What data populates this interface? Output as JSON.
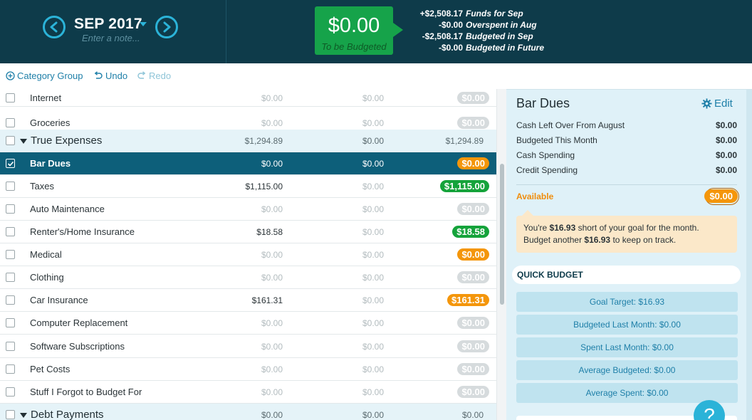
{
  "header": {
    "month": "SEP 2017",
    "note_placeholder": "Enter a note...",
    "to_be_budgeted": {
      "amount": "$0.00",
      "label": "To be Budgeted"
    },
    "summary": [
      {
        "amount": "+$2,508.17",
        "label": "Funds for Sep"
      },
      {
        "amount": "-$0.00",
        "label": "Overspent in Aug"
      },
      {
        "amount": "-$2,508.17",
        "label": "Budgeted in Sep"
      },
      {
        "amount": "-$0.00",
        "label": "Budgeted in Future"
      }
    ]
  },
  "toolbar": {
    "category_group": "Category Group",
    "undo": "Undo",
    "redo": "Redo"
  },
  "rows": [
    {
      "name": "Internet",
      "budgeted": "$0.00",
      "activity": "$0.00",
      "available": "$0.00",
      "pill": "gray"
    },
    {
      "name": "Groceries",
      "budgeted": "$0.00",
      "activity": "$0.00",
      "available": "$0.00",
      "pill": "gray"
    },
    {
      "name": "True Expenses",
      "budgeted": "$1,294.89",
      "activity": "$0.00",
      "available": "$1,294.89",
      "group": true
    },
    {
      "name": "Bar Dues",
      "budgeted": "$0.00",
      "activity": "$0.00",
      "available": "$0.00",
      "pill": "orange",
      "selected": true
    },
    {
      "name": "Taxes",
      "budgeted": "$1,115.00",
      "activity": "$0.00",
      "available": "$1,115.00",
      "pill": "green"
    },
    {
      "name": "Auto Maintenance",
      "budgeted": "$0.00",
      "activity": "$0.00",
      "available": "$0.00",
      "pill": "gray"
    },
    {
      "name": "Renter's/Home Insurance",
      "budgeted": "$18.58",
      "activity": "$0.00",
      "available": "$18.58",
      "pill": "green"
    },
    {
      "name": "Medical",
      "budgeted": "$0.00",
      "activity": "$0.00",
      "available": "$0.00",
      "pill": "orange"
    },
    {
      "name": "Clothing",
      "budgeted": "$0.00",
      "activity": "$0.00",
      "available": "$0.00",
      "pill": "gray"
    },
    {
      "name": "Car Insurance",
      "budgeted": "$161.31",
      "activity": "$0.00",
      "available": "$161.31",
      "pill": "orange"
    },
    {
      "name": "Computer Replacement",
      "budgeted": "$0.00",
      "activity": "$0.00",
      "available": "$0.00",
      "pill": "gray"
    },
    {
      "name": "Software Subscriptions",
      "budgeted": "$0.00",
      "activity": "$0.00",
      "available": "$0.00",
      "pill": "gray"
    },
    {
      "name": "Pet Costs",
      "budgeted": "$0.00",
      "activity": "$0.00",
      "available": "$0.00",
      "pill": "gray"
    },
    {
      "name": "Stuff I Forgot to Budget For",
      "budgeted": "$0.00",
      "activity": "$0.00",
      "available": "$0.00",
      "pill": "gray"
    },
    {
      "name": "Debt Payments",
      "budgeted": "$0.00",
      "activity": "$0.00",
      "available": "$0.00",
      "group": true
    }
  ],
  "inspector": {
    "title": "Bar Dues",
    "edit": "Edit",
    "lines": [
      {
        "label": "Cash Left Over From August",
        "value": "$0.00"
      },
      {
        "label": "Budgeted This Month",
        "value": "$0.00"
      },
      {
        "label": "Cash Spending",
        "value": "$0.00"
      },
      {
        "label": "Credit Spending",
        "value": "$0.00"
      }
    ],
    "available_label": "Available",
    "available_value": "$0.00",
    "message_line1_pre": "You're ",
    "message_line1_amt": "$16.93",
    "message_line1_post": " short of your goal for the month.",
    "message_line2_pre": "Budget another ",
    "message_line2_amt": "$16.93",
    "message_line2_post": " to keep on track.",
    "quick_budget_title": "QUICK BUDGET",
    "quick_budget": [
      "Goal Target: $16.93",
      "Budgeted Last Month: $0.00",
      "Spent Last Month: $0.00",
      "Average Budgeted: $0.00",
      "Average Spent: $0.00"
    ],
    "help": "?"
  },
  "colors": {
    "header_bg": "#0e3b4a",
    "accent": "#2bb3d8",
    "positive": "#15a33b",
    "warning": "#f4960b",
    "selected_row": "#0d5f7a"
  }
}
